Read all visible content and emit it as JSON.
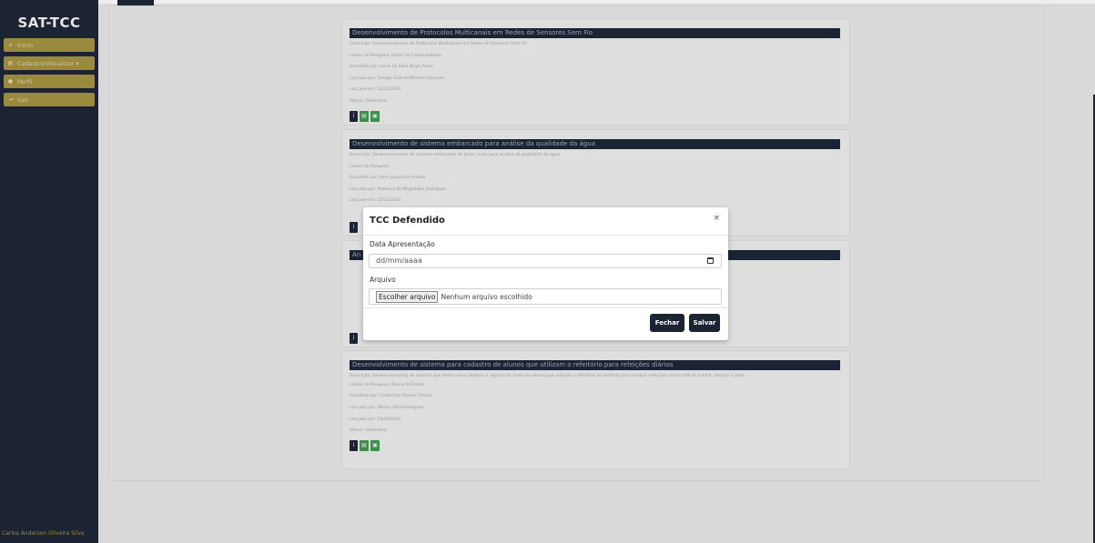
{
  "app": {
    "brand": "SAT-TCC",
    "user_name": "Carlos Anderson Oliveira Silva"
  },
  "sidebar": {
    "items": [
      {
        "label": "Início",
        "icon": "home-icon"
      },
      {
        "label": "Cadastro/Visualizar",
        "icon": "folder-icon",
        "caret": "▾"
      },
      {
        "label": "Perfil",
        "icon": "user-icon"
      },
      {
        "label": "Sair",
        "icon": "logout-icon"
      }
    ]
  },
  "tccs": [
    {
      "title": "Desenvolvimento de Protocolos Multicanais em Redes de Sensores Sem Fio",
      "description": "Descrição: Desenvolvimento de Protocolos Multicanais em Redes de Sensores Sem Fio",
      "lines": "Linhas de Pesquisa: Redes de Computadores",
      "chosen_by": "Escolhido por: Josue da Silva Bispo Alves",
      "posted_by": "Lançado por: George Gabriel Mendes Dourado",
      "posted_on": "Lançado em: 12/12/2023",
      "status": "Status: Defendido"
    },
    {
      "title": "Desenvolvimento de sistema embarcado para análise da qualidade da água",
      "description": "Descrição: Desenvolvimento de sistema embarcado de baixo custo para análise da qualidade da água",
      "lines": "Linhas de Pesquisa:",
      "chosen_by": "Escolhido por: John Junqueira Aranha",
      "posted_by": "Lançado por: Matheus de Magalhães Rodrigues",
      "posted_on": "Lançado em: 15/12/2023",
      "status": ""
    },
    {
      "title": "An",
      "description": "",
      "lines": "",
      "chosen_by": "",
      "posted_by": "",
      "posted_on": "",
      "status": ""
    },
    {
      "title": "Desenvolvimento de sistema para cadastro de alunos que utilizam o refeitório para refeições diários",
      "description": "Descrição: Desenvolvimento de sistema que tenha como objetivo o registro de todos os alunos que utilizam o refeitório do instituto para realizar refeições como café da manhã, almoço e janta",
      "lines": "Linhas de Pesquisa: Banco de Dados",
      "chosen_by": "Escolhido por: Guilherme Ramos Correia",
      "posted_by": "Lançado por: Wilson Silva Rodrigues",
      "posted_on": "Lançado em: 23/04/2024",
      "status": "Status: Defendido"
    }
  ],
  "actions": {
    "info": "i",
    "view": "▤",
    "edit": "▣"
  },
  "modal": {
    "title": "TCC Defendido",
    "close": "×",
    "date_label": "Data Apresentação",
    "date_placeholder": "dd/mm/aaaa",
    "file_label": "Arquivo",
    "file_button": "Escolher arquivo",
    "file_status": "Nenhum arquivo escolhido",
    "close_button": "Fechar",
    "save_button": "Salvar"
  },
  "colors": {
    "sidebar": "#1c2333",
    "nav_item": "#9a8a3e",
    "green": "#3f8f4c"
  }
}
